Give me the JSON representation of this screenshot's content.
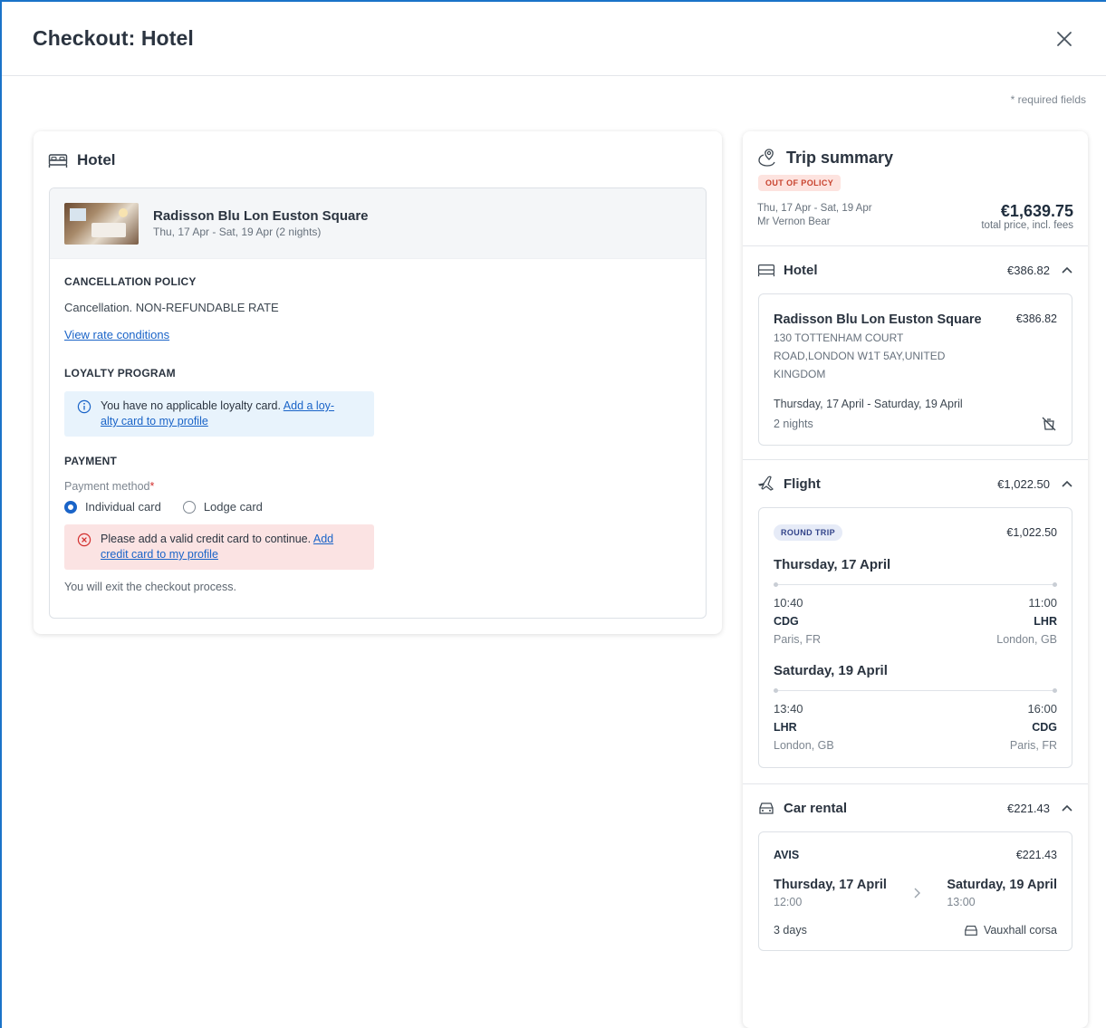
{
  "modal": {
    "title": "Checkout: Hotel",
    "required_note": "* required fields"
  },
  "hotel_card": {
    "title": "Hotel",
    "hotel_name": "Radisson Blu Lon Euston Square",
    "dates": "Thu, 17 Apr - Sat, 19 Apr (2 nights)",
    "cancellation": {
      "title": "CANCELLATION POLICY",
      "text": "Cancellation. NON-REFUNDABLE RATE",
      "link": "View rate conditions"
    },
    "loyalty": {
      "title": "LOYALTY PROGRAM",
      "text": "You have no applicable loyalty card.",
      "link_part1": "Add a loy-",
      "link_part2": "alty card to my profile"
    },
    "payment": {
      "title": "PAYMENT",
      "method_label": "Payment method",
      "required_mark": "*",
      "options": [
        "Individual card",
        "Lodge card"
      ],
      "selected": "Individual card",
      "error_text": "Please add a valid credit card to continue.",
      "error_link_part1": "Add",
      "error_link_part2": "credit card to my profile",
      "exit_note": "You will exit the checkout process."
    }
  },
  "trip_summary": {
    "title": "Trip summary",
    "badge": "OUT OF POLICY",
    "dates": "Thu, 17 Apr - Sat, 19 Apr",
    "traveler": "Mr Vernon Bear",
    "total_price": "€1,639.75",
    "total_note": "total price, incl. fees",
    "hotel": {
      "label": "Hotel",
      "amount": "€386.82",
      "name": "Radisson Blu Lon Euston Square",
      "price": "€386.82",
      "address_line1": "130 TOTTENHAM COURT",
      "address_line2": "ROAD,LONDON W1T 5AY,UNITED",
      "address_line3": "KINGDOM",
      "stay": "Thursday, 17 April - Saturday, 19 April",
      "nights": "2 nights"
    },
    "flight": {
      "label": "Flight",
      "amount": "€1,022.50",
      "badge": "ROUND TRIP",
      "price": "€1,022.50",
      "outbound": {
        "day": "Thursday, 17 April",
        "dep_time": "10:40",
        "arr_time": "11:00",
        "dep_code": "CDG",
        "arr_code": "LHR",
        "dep_city": "Paris, FR",
        "arr_city": "London, GB"
      },
      "return": {
        "day": "Saturday, 19 April",
        "dep_time": "13:40",
        "arr_time": "16:00",
        "dep_code": "LHR",
        "arr_code": "CDG",
        "dep_city": "London, GB",
        "arr_city": "Paris, FR"
      }
    },
    "car": {
      "label": "Car rental",
      "amount": "€221.43",
      "vendor": "AVIS",
      "price": "€221.43",
      "pickup_day": "Thursday, 17 April",
      "pickup_time": "12:00",
      "dropoff_day": "Saturday, 19 April",
      "dropoff_time": "13:00",
      "duration": "3 days",
      "model": "Vauxhall corsa"
    }
  },
  "colors": {
    "accent": "#1a64c8",
    "error_bg": "#fbe3e3",
    "info_bg": "#e8f3fc",
    "badge_bg": "#fde3df",
    "badge_text": "#c8432e"
  }
}
